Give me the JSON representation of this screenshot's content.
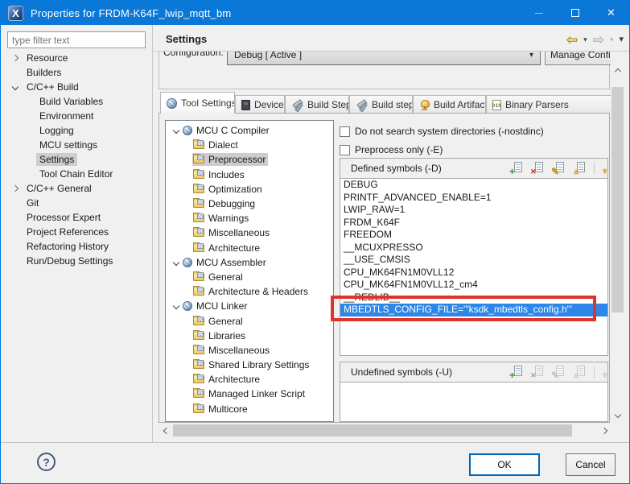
{
  "window": {
    "title": "Properties for FRDM-K64F_lwip_mqtt_bm"
  },
  "titlebar_icons": {
    "close": "✕"
  },
  "sidebar": {
    "filter_placeholder": "type filter text",
    "items": [
      {
        "label": "Resource",
        "state": "collapsed"
      },
      {
        "label": "Builders"
      },
      {
        "label": "C/C++ Build",
        "state": "expanded"
      },
      {
        "label": "Build Variables"
      },
      {
        "label": "Environment"
      },
      {
        "label": "Logging"
      },
      {
        "label": "MCU settings"
      },
      {
        "label": "Settings",
        "selected": true
      },
      {
        "label": "Tool Chain Editor"
      },
      {
        "label": "C/C++ General",
        "state": "collapsed"
      },
      {
        "label": "Git"
      },
      {
        "label": "Processor Expert"
      },
      {
        "label": "Project References"
      },
      {
        "label": "Refactoring History"
      },
      {
        "label": "Run/Debug Settings"
      }
    ]
  },
  "header": {
    "title": "Settings"
  },
  "config": {
    "label": "Configuration:",
    "value": "Debug [ Active ]",
    "manage_button": "Manage Configuratio"
  },
  "tabs": [
    {
      "label": "Tool Settings",
      "active": true
    },
    {
      "label": "Devices"
    },
    {
      "label": "Build Steps"
    },
    {
      "label": "Build steps"
    },
    {
      "label": "Build Artifact"
    },
    {
      "label": "Binary Parsers",
      "badge": "010"
    }
  ],
  "tool_tree": {
    "items": [
      "MCU C Compiler",
      "Dialect",
      "Preprocessor",
      "Includes",
      "Optimization",
      "Debugging",
      "Warnings",
      "Miscellaneous",
      "Architecture",
      "MCU Assembler",
      "General",
      "Architecture & Headers",
      "MCU Linker",
      "General",
      "Libraries",
      "Miscellaneous",
      "Shared Library Settings",
      "Architecture",
      "Managed Linker Script",
      "Multicore"
    ],
    "selected": "Preprocessor"
  },
  "options": [
    {
      "label": "Do not search system directories (-nostdinc)",
      "checked": false
    },
    {
      "label": "Preprocess only (-E)",
      "checked": false
    }
  ],
  "defined_symbols": {
    "title": "Defined symbols (-D)",
    "items": [
      "DEBUG",
      "PRINTF_ADVANCED_ENABLE=1",
      "LWIP_RAW=1",
      "FRDM_K64F",
      "FREEDOM",
      "__MCUXPRESSO",
      "__USE_CMSIS",
      "CPU_MK64FN1M0VLL12",
      "CPU_MK64FN1M0VLL12_cm4",
      "__REDLIB__",
      "MBEDTLS_CONFIG_FILE='\"ksdk_mbedtls_config.h\"'"
    ],
    "selected_index": 10
  },
  "undefined_symbols": {
    "title": "Undefined symbols (-U)",
    "items": []
  },
  "footer": {
    "help": "?",
    "ok": "OK",
    "cancel": "Cancel"
  },
  "icons": {
    "back": "⇦",
    "forward": "⇨",
    "menu_caret": "▾",
    "combo_caret": "▾",
    "plus": "+",
    "delete": "✕",
    "edit": "✎",
    "move_up": "▲",
    "move_down": "▼",
    "logo": "X"
  },
  "colors": {
    "titlebar": "#0b77d7",
    "selection_blue": "#2c87e8",
    "tree_selection": "#cdcdcd",
    "annotation_red": "#e0332d",
    "background": "#f0f0f0"
  }
}
